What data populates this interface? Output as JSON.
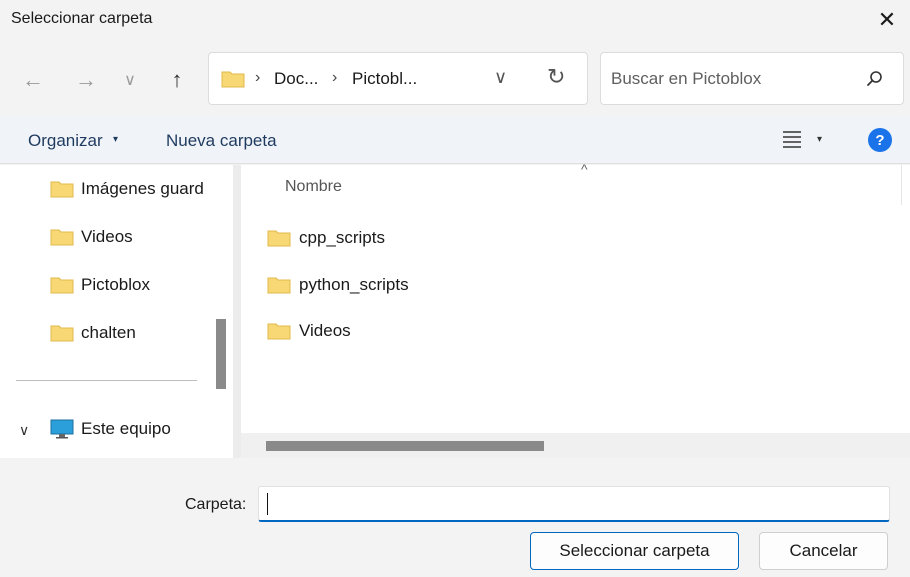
{
  "window": {
    "title": "Seleccionar carpeta",
    "close_symbol": "✕"
  },
  "nav": {
    "back_symbol": "←",
    "forward_symbol": "→",
    "recent_symbol": "∨",
    "up_symbol": "↑"
  },
  "address": {
    "separator": "›",
    "crumbs": [
      "Doc...",
      "Pictobl..."
    ],
    "dropdown_symbol": "∨",
    "refresh_symbol": "↻"
  },
  "search": {
    "placeholder": "Buscar en Pictoblox"
  },
  "toolbar": {
    "organize_label": "Organizar",
    "caret": "▾",
    "new_folder_label": "Nueva carpeta",
    "view_caret": "▾",
    "help_label": "?"
  },
  "sidebar": {
    "items": [
      {
        "label": "Imágenes guard",
        "icon": "folder-icon"
      },
      {
        "label": "Videos",
        "icon": "folder-icon"
      },
      {
        "label": "Pictoblox",
        "icon": "folder-icon"
      },
      {
        "label": "chalten",
        "icon": "folder-icon"
      }
    ],
    "this_pc": {
      "label": "Este equipo",
      "icon": "monitor-icon",
      "chevron": "∨"
    }
  },
  "files": {
    "column_name": "Nombre",
    "sort_symbol": "^",
    "items": [
      {
        "name": "cpp_scripts",
        "icon": "folder-icon"
      },
      {
        "name": "python_scripts",
        "icon": "folder-icon"
      },
      {
        "name": "Videos",
        "icon": "folder-icon"
      }
    ]
  },
  "footer": {
    "folder_label": "Carpeta:",
    "folder_value": "",
    "select_button": "Seleccionar carpeta",
    "cancel_button": "Cancelar"
  },
  "colors": {
    "accent": "#0067c0",
    "folder": "#f8d775",
    "help": "#1a73e8"
  }
}
